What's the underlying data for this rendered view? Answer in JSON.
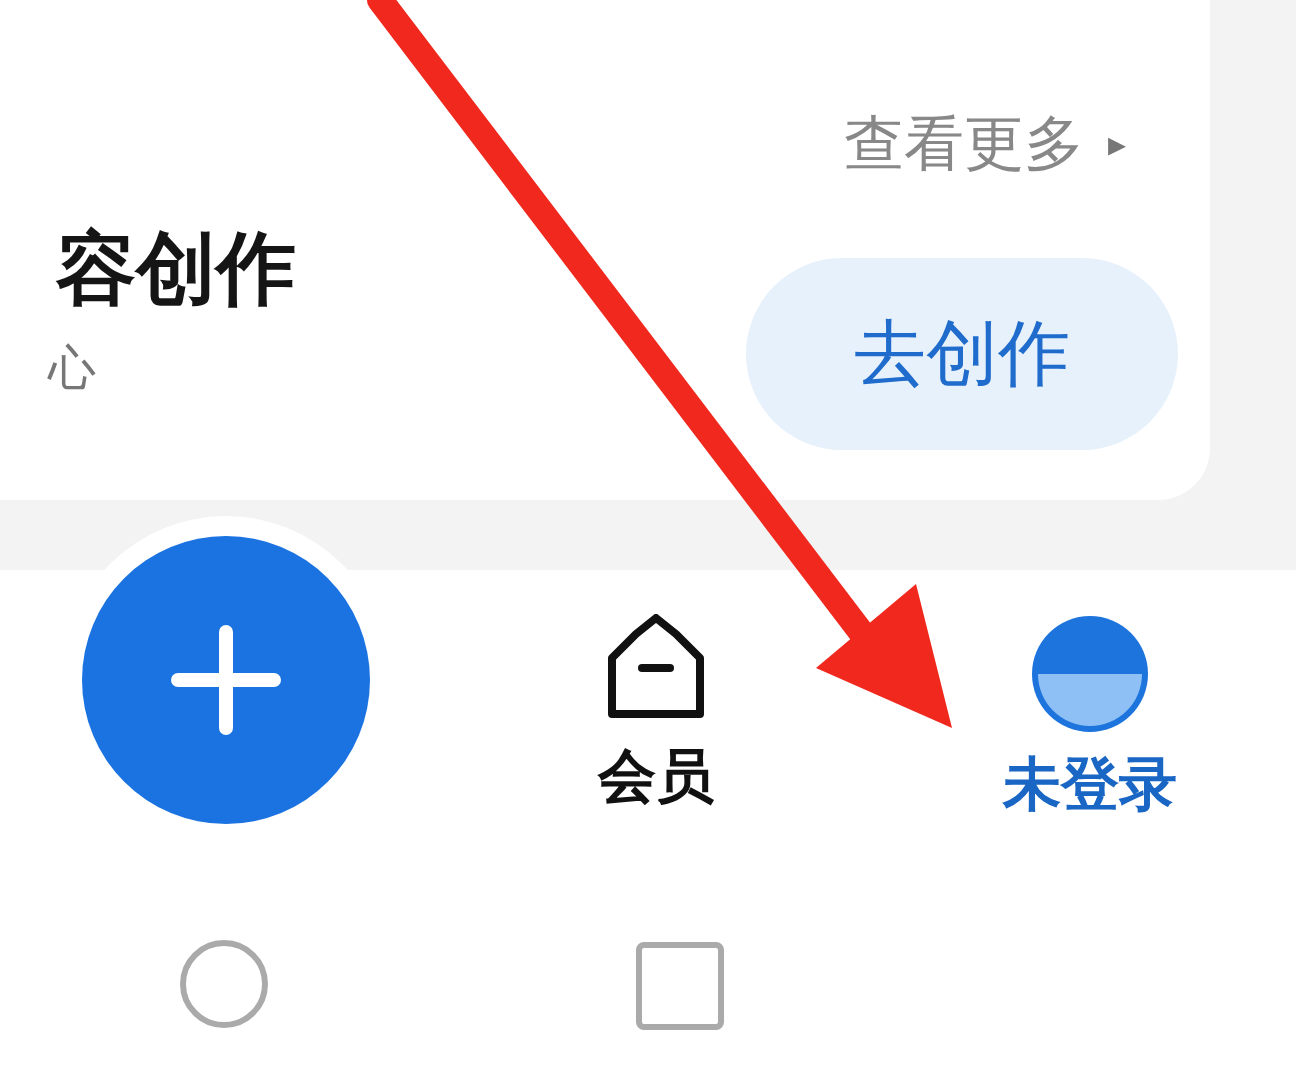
{
  "card": {
    "title": "容创作",
    "subtitle": "心",
    "more_link": "查看更多",
    "more_caret": "▸",
    "action_button": "去创作"
  },
  "bottom_nav": [
    {
      "kind": "member",
      "label": "会员",
      "selected": false
    },
    {
      "kind": "account",
      "label": "未登录",
      "selected": true
    }
  ],
  "system_nav": [
    {
      "kind": "home"
    },
    {
      "kind": "recents"
    }
  ]
}
